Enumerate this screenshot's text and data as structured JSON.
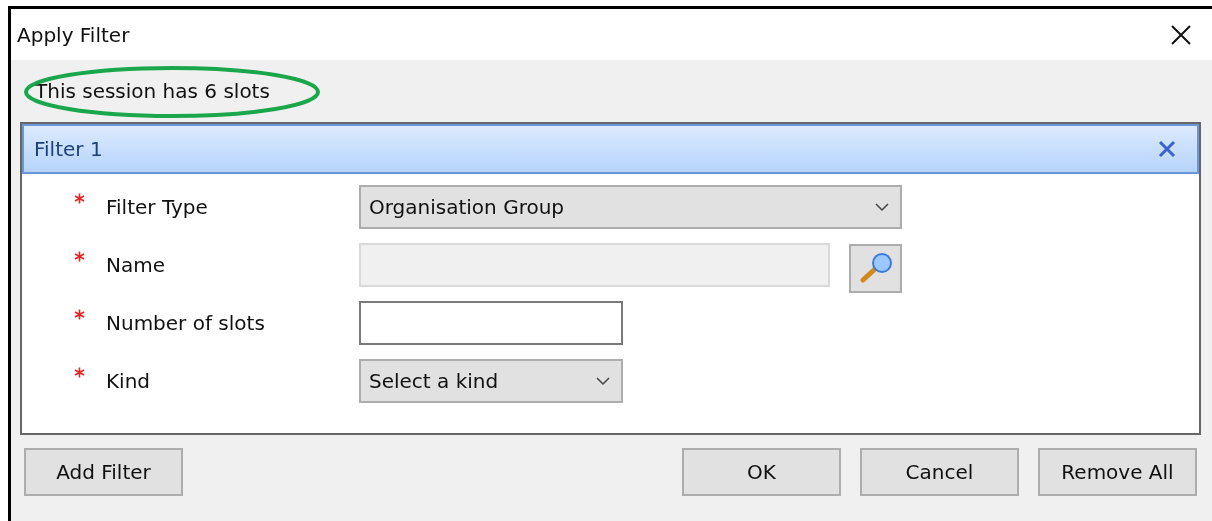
{
  "window": {
    "title": "Apply Filter"
  },
  "session_info": "This session has 6 slots",
  "filter": {
    "title": "Filter 1",
    "fields": [
      {
        "label": "Filter Type",
        "required": true,
        "kind": "select",
        "value": "Organisation Group"
      },
      {
        "label": "Name",
        "required": true,
        "kind": "lookup",
        "disabled": true
      },
      {
        "label": "Number of slots",
        "required": true,
        "kind": "text"
      },
      {
        "label": "Kind",
        "required": true,
        "kind": "select",
        "value": "Select a kind"
      }
    ]
  },
  "buttons": {
    "left": [
      "Add Filter"
    ],
    "right": [
      "OK",
      "Cancel",
      "Remove All"
    ]
  }
}
